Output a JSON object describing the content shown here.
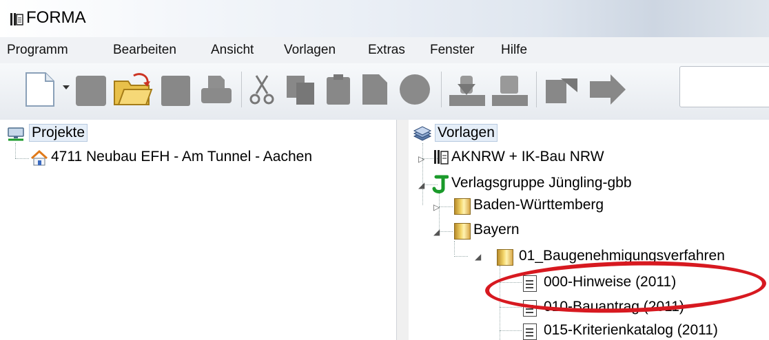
{
  "window": {
    "title": "FORMA"
  },
  "menu": [
    "Programm",
    "Bearbeiten",
    "Ansicht",
    "Vorlagen",
    "Extras",
    "Fenster",
    "Hilfe"
  ],
  "toolbar": {
    "buttons": [
      "new-document-icon",
      "dropdown-arrow-icon",
      "open-icon",
      "folder-open-icon",
      "save-icon",
      "print-icon",
      "cut-icon",
      "copy-icon",
      "paste-icon",
      "document-icon",
      "record-icon",
      "import-icon",
      "export-icon",
      "back-icon",
      "forward-icon"
    ]
  },
  "left_tree": {
    "root": "Projekte",
    "items": [
      "4711 Neubau EFH - Am Tunnel - Aachen"
    ]
  },
  "right_tree": {
    "root": "Vorlagen",
    "items": {
      "aknrw": "AKNRW + IK-Bau NRW",
      "verlag": "Verlagsgruppe Jüngling-gbb",
      "bw": "Baden-Württemberg",
      "bayern": "Bayern",
      "folder01": "01_Baugenehmigungsverfahren",
      "doc000": "000-Hinweise (2011)",
      "doc010": "010-Bauantrag (2011)",
      "doc015": "015-Kriterienkatalog (2011)"
    }
  },
  "colors": {
    "highlight_ellipse": "#d71920",
    "accent_green": "#1a9a2a"
  }
}
